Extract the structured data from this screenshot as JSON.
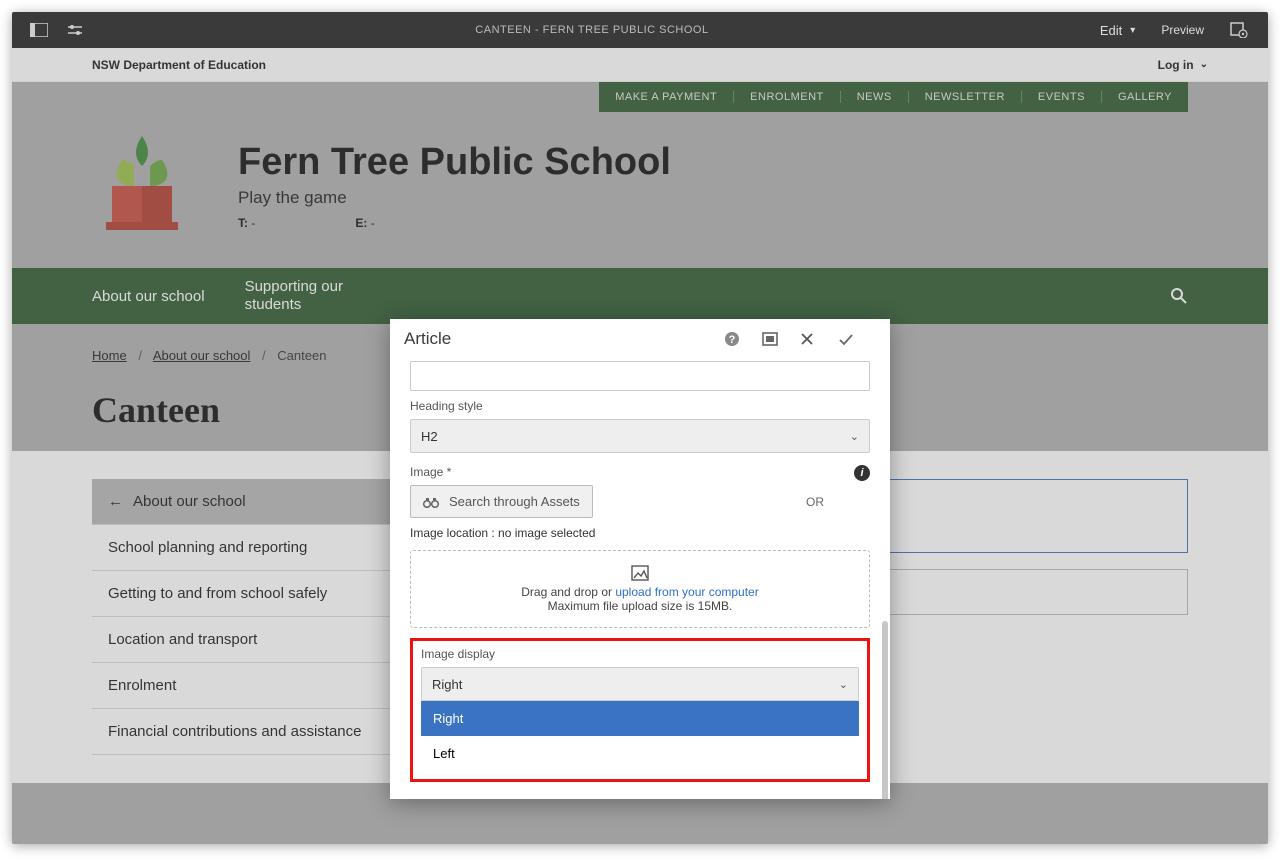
{
  "editor": {
    "title": "CANTEEN - FERN TREE PUBLIC SCHOOL",
    "edit_label": "Edit",
    "preview_label": "Preview"
  },
  "dept": {
    "name": "NSW Department of Education",
    "login_label": "Log in"
  },
  "utility_nav": [
    "MAKE A PAYMENT",
    "ENROLMENT",
    "NEWS",
    "NEWSLETTER",
    "EVENTS",
    "GALLERY"
  ],
  "school": {
    "name": "Fern Tree Public School",
    "tagline": "Play the game",
    "t_label": "T:",
    "t_val": "-",
    "e_label": "E:",
    "e_val": "-"
  },
  "main_nav": {
    "item1": "About our school",
    "item2": "Supporting our students"
  },
  "breadcrumb": {
    "home": "Home",
    "level1": "About our school",
    "current": "Canteen"
  },
  "page_title": "Canteen",
  "sidebar": {
    "items": [
      "About our school",
      "School planning and reporting",
      "Getting to and from school safely",
      "Location and transport",
      "Enrolment",
      "Financial contributions and assistance"
    ]
  },
  "modal": {
    "title": "Article",
    "heading_style_label": "Heading style",
    "heading_style_value": "H2",
    "image_label": "Image *",
    "asset_search": "Search through Assets",
    "or": "OR",
    "image_location": "Image location : no image selected",
    "drop_line1_pre": "Drag and drop or ",
    "drop_line1_link": "upload from your computer",
    "drop_line2": "Maximum file upload size is 15MB.",
    "image_display_label": "Image display",
    "image_display_value": "Right",
    "options": {
      "right": "Right",
      "left": "Left"
    }
  }
}
